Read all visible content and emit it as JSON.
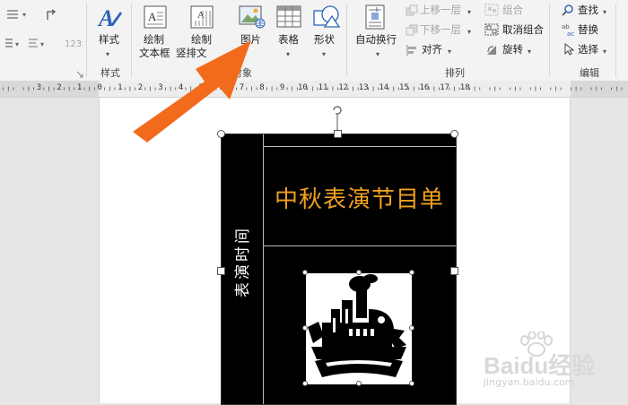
{
  "ribbon": {
    "styles_button": "样式",
    "styles_group": "样式",
    "draw_textbox": "绘制\n文本框",
    "draw_textbox_l1": "绘制",
    "draw_textbox_l2": "文本框",
    "draw_vertical_l1": "绘制",
    "draw_vertical_l2": "竖排文",
    "picture_button": "图片",
    "table_button": "表格",
    "shapes_button": "形状",
    "objects_group": "对象",
    "wrap_text_button": "自动换行",
    "bring_forward": "上移一层",
    "send_backward": "下移一层",
    "align": "对齐",
    "group": "组合",
    "ungroup": "取消组合",
    "rotate": "旋转",
    "arrange_group": "排列",
    "find": "查找",
    "replace": "替换",
    "select": "选择",
    "edit_group": "编辑",
    "num_123": "123"
  },
  "ruler": {
    "labels": [
      "3",
      "2",
      "1",
      "0",
      "1",
      "2",
      "3",
      "4",
      "5",
      "6",
      "7",
      "8",
      "9",
      "10",
      "11",
      "12",
      "13",
      "14",
      "15",
      "16",
      "17",
      "18"
    ]
  },
  "document": {
    "title": "中秋表演节目单",
    "vertical_label": "表演时间"
  },
  "watermark": {
    "brand": "Baidu经验",
    "url": "jingyan.baidu.com"
  },
  "colors": {
    "accent_arrow": "#f26b1d",
    "title_color": "#f0a020",
    "ribbon_bg": "#f3f3f3"
  }
}
